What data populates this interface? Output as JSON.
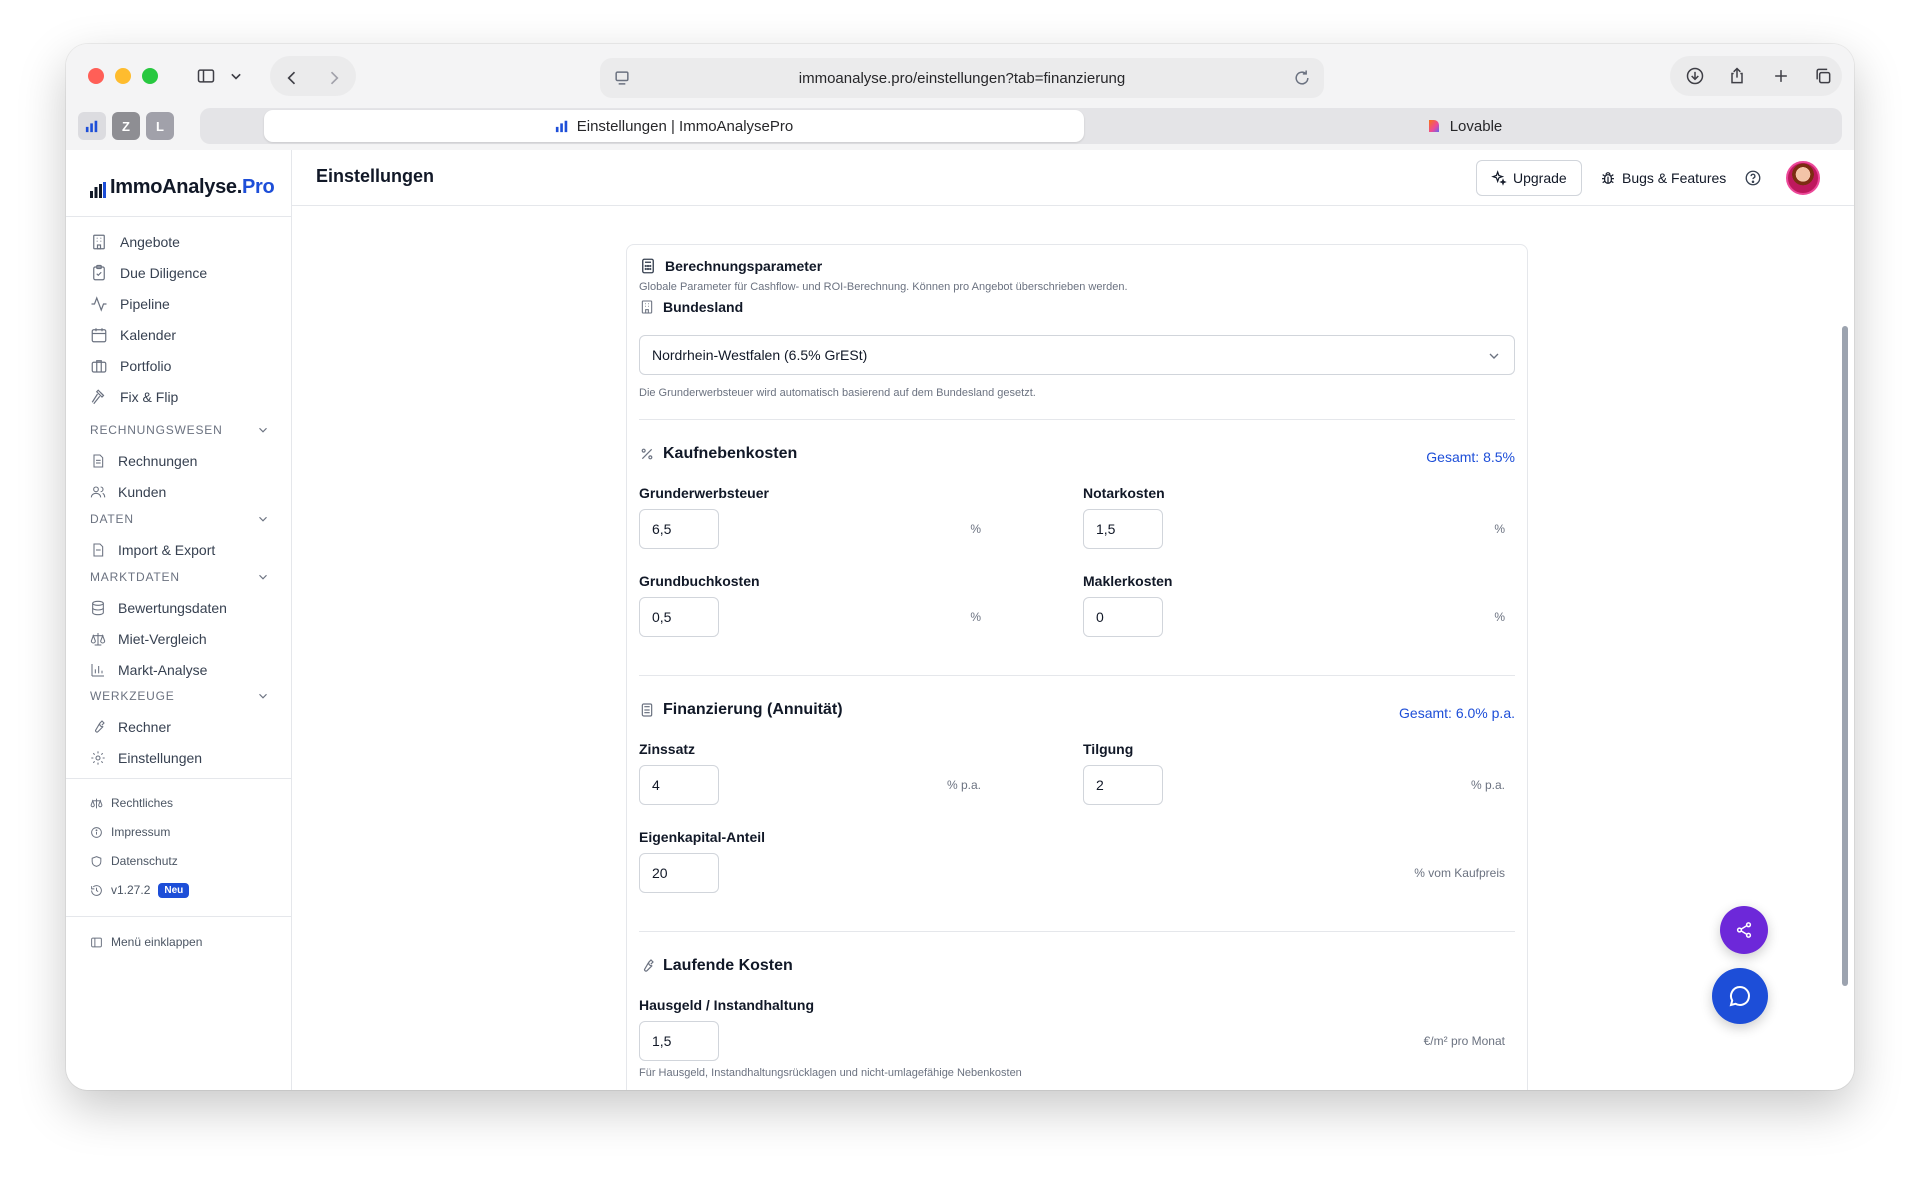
{
  "browser": {
    "url": "immoanalyse.pro/einstellungen?tab=finanzierung",
    "tabs": [
      {
        "label": "Einstellungen | ImmoAnalysePro",
        "active": true
      },
      {
        "label": "Lovable",
        "active": false
      }
    ],
    "pinned_tabs": [
      "Z",
      "L"
    ]
  },
  "app": {
    "logo_main": "ImmoAnalyse.",
    "logo_accent": "Pro",
    "page_title": "Einstellungen",
    "upgrade_label": "Upgrade",
    "bugs_label": "Bugs & Features"
  },
  "sidebar": {
    "main_items": [
      {
        "label": "Angebote",
        "icon": "building-icon"
      },
      {
        "label": "Due Diligence",
        "icon": "clipboard-check-icon"
      },
      {
        "label": "Pipeline",
        "icon": "activity-icon"
      },
      {
        "label": "Kalender",
        "icon": "calendar-icon"
      },
      {
        "label": "Portfolio",
        "icon": "briefcase-icon"
      },
      {
        "label": "Fix & Flip",
        "icon": "hammer-icon"
      }
    ],
    "sections": [
      {
        "title": "RECHNUNGSWESEN",
        "items": [
          {
            "label": "Rechnungen",
            "icon": "file-text-icon"
          },
          {
            "label": "Kunden",
            "icon": "users-icon"
          }
        ]
      },
      {
        "title": "DATEN",
        "items": [
          {
            "label": "Import & Export",
            "icon": "file-icon"
          }
        ]
      },
      {
        "title": "MARKTDATEN",
        "items": [
          {
            "label": "Bewertungsdaten",
            "icon": "database-icon"
          },
          {
            "label": "Miet-Vergleich",
            "icon": "scale-icon"
          },
          {
            "label": "Markt-Analyse",
            "icon": "bar-chart-icon"
          }
        ]
      },
      {
        "title": "WERKZEUGE",
        "items": [
          {
            "label": "Rechner",
            "icon": "wrench-icon"
          },
          {
            "label": "Einstellungen",
            "icon": "gear-icon"
          }
        ]
      }
    ],
    "footer": {
      "rechtliches": "Rechtliches",
      "impressum": "Impressum",
      "datenschutz": "Datenschutz",
      "version": "v1.27.2",
      "version_badge": "Neu",
      "collapse": "Menü einklappen"
    }
  },
  "settings": {
    "card_title": "Berechnungsparameter",
    "card_description": "Globale Parameter für Cashflow- und ROI-Berechnung. Können pro Angebot überschrieben werden.",
    "bundesland_label": "Bundesland",
    "bundesland_value": "Nordrhein-Westfalen (6.5% GrESt)",
    "bundesland_hint": "Die Grunderwerbsteuer wird automatisch basierend auf dem Bundesland gesetzt.",
    "kaufnebenkosten": {
      "title": "Kaufnebenkosten",
      "total": "Gesamt: 8.5%",
      "grunderwerbsteuer_label": "Grunderwerbsteuer",
      "grunderwerbsteuer_value": "6,5",
      "grunderwerbsteuer_unit": "%",
      "notarkosten_label": "Notarkosten",
      "notarkosten_value": "1,5",
      "notarkosten_unit": "%",
      "grundbuchkosten_label": "Grundbuchkosten",
      "grundbuchkosten_value": "0,5",
      "grundbuchkosten_unit": "%",
      "maklerkosten_label": "Maklerkosten",
      "maklerkosten_value": "0",
      "maklerkosten_unit": "%"
    },
    "finanzierung": {
      "title": "Finanzierung (Annuität)",
      "total": "Gesamt: 6.0% p.a.",
      "zinssatz_label": "Zinssatz",
      "zinssatz_value": "4",
      "zinssatz_unit": "% p.a.",
      "tilgung_label": "Tilgung",
      "tilgung_value": "2",
      "tilgung_unit": "% p.a.",
      "eigenkapital_label": "Eigenkapital-Anteil",
      "eigenkapital_value": "20",
      "eigenkapital_unit": "% vom Kaufpreis"
    },
    "laufende_kosten": {
      "title": "Laufende Kosten",
      "hausgeld_label": "Hausgeld / Instandhaltung",
      "hausgeld_value": "1,5",
      "hausgeld_unit": "€/m² pro Monat",
      "hausgeld_hint": "Für Hausgeld, Instandhaltungsrücklagen und nicht-umlagefähige Nebenkosten"
    }
  },
  "colors": {
    "accent": "#1d4ed8",
    "share_fab": "#6d28d9",
    "chat_fab": "#1d4ed8"
  }
}
